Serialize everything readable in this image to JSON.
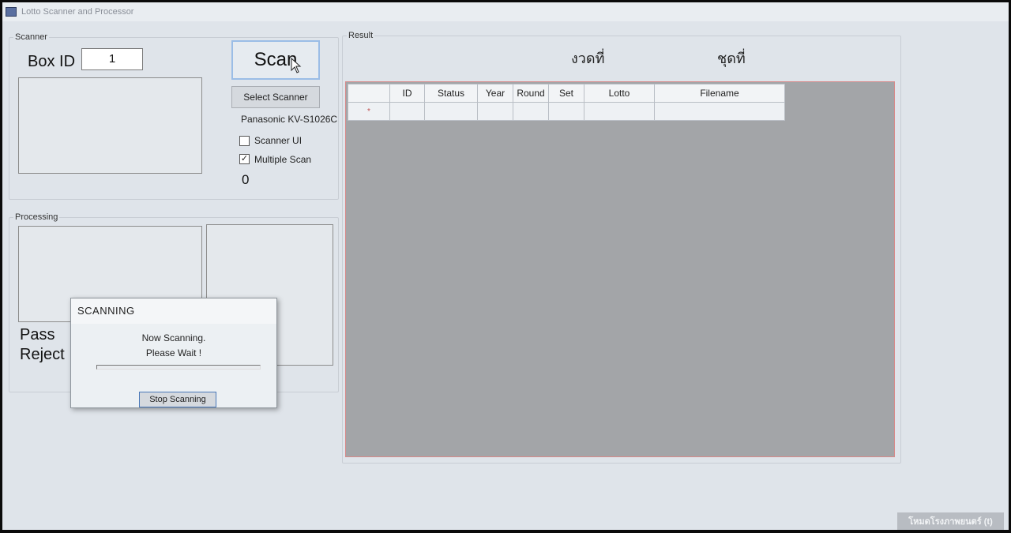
{
  "window": {
    "title": "Lotto Scanner and Processor"
  },
  "scanner": {
    "group_label": "Scanner",
    "box_id_label": "Box ID",
    "box_id_value": "1",
    "scan_button": "Scan",
    "select_scanner_button": "Select Scanner",
    "scanner_name": "Panasonic KV-S1026C",
    "scanner_ui_label": "Scanner UI",
    "scanner_ui_checked": false,
    "multiple_scan_label": "Multiple Scan",
    "multiple_scan_checked": true,
    "count": "0"
  },
  "processing": {
    "group_label": "Processing",
    "pass_label": "Pass",
    "reject_label": "Reject"
  },
  "result": {
    "group_label": "Result",
    "period_label": "งวดที่",
    "set_label": "ชุดที่",
    "columns": [
      "ID",
      "Status",
      "Year",
      "Round",
      "Set",
      "Lotto",
      "Filename"
    ],
    "new_row_marker": "*"
  },
  "dialog": {
    "title": "SCANNING",
    "message_line1": "Now Scanning.",
    "message_line2": "Please Wait !",
    "progress": 0,
    "stop_button": "Stop Scanning"
  },
  "watermark": "โหมดโรงภาพยนตร์ (t)",
  "colors": {
    "window_bg": "#dfe4ea",
    "grid_bg": "#a3a5a8",
    "scan_button_border": "#9bbde6",
    "grid_border": "#d78a8a"
  }
}
